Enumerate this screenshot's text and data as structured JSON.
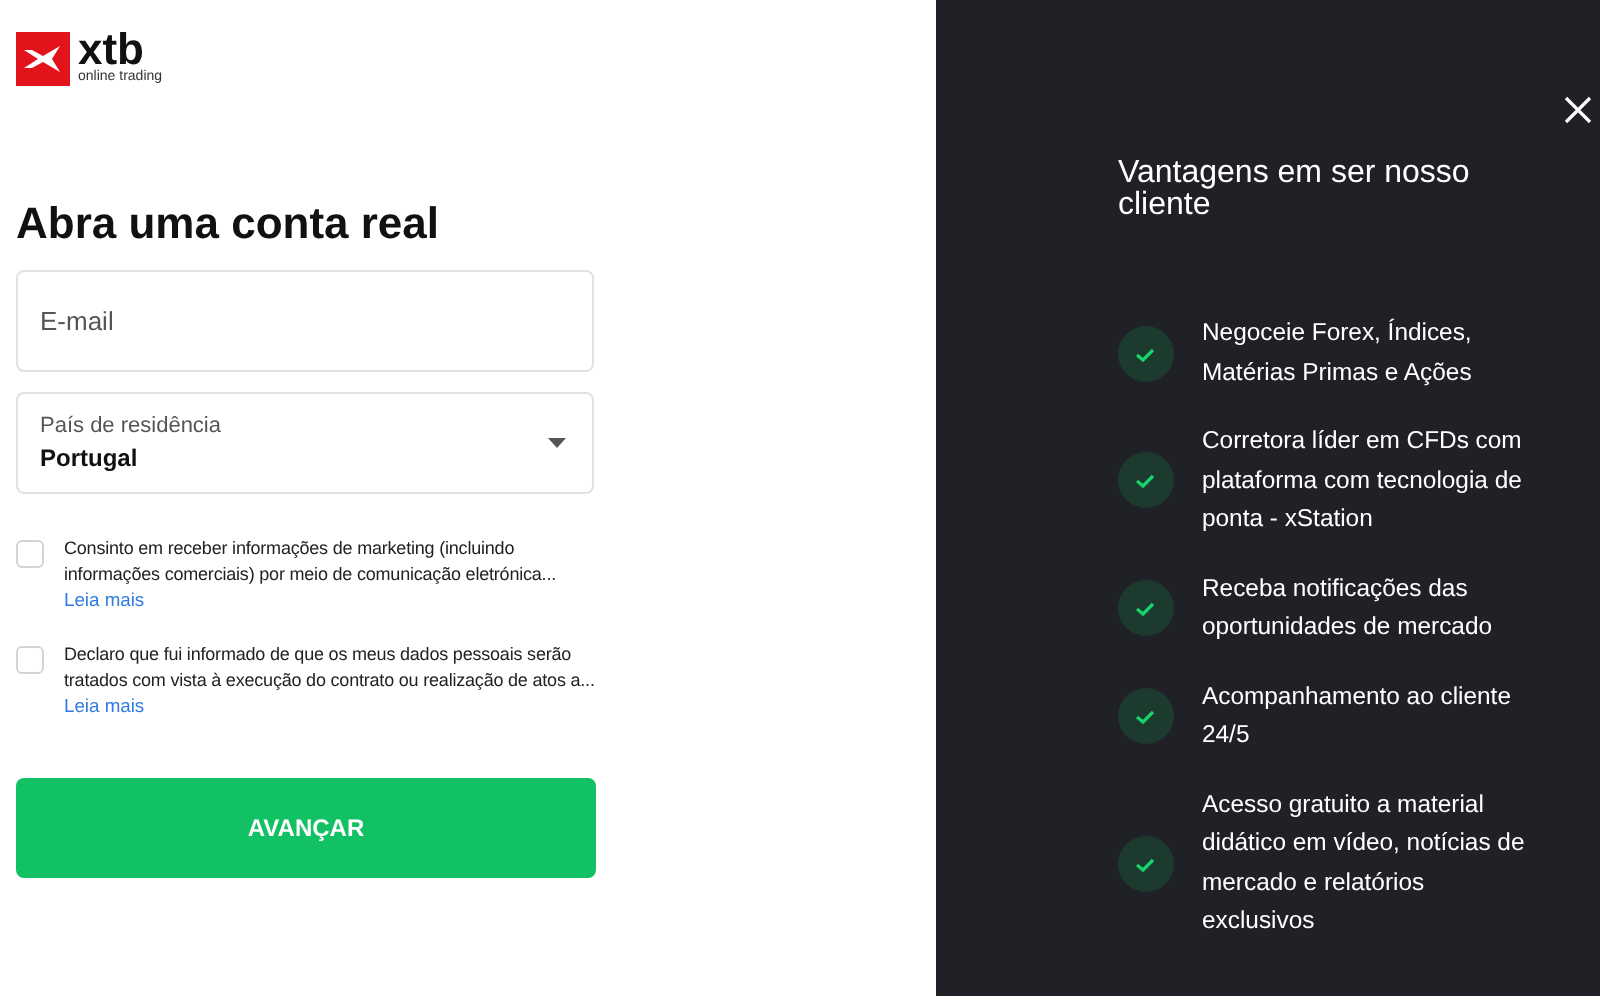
{
  "logo": {
    "wordmark": "xtb",
    "tagline": "online trading"
  },
  "heading": "Abra uma conta real",
  "email_field": {
    "placeholder": "E-mail"
  },
  "country_field": {
    "label": "País de residência",
    "value": "Portugal"
  },
  "consents": [
    {
      "text": "Consinto em receber informações de marketing (incluindo informações comerciais) por meio de comunicação eletrónica...",
      "link": "Leia mais",
      "checked": false
    },
    {
      "text": "Declaro que fui informado de que os meus dados pessoais serão tratados com vista à execução do contrato ou realização de atos a...",
      "link": "Leia mais",
      "checked": false
    }
  ],
  "submit_button": "AVANÇAR",
  "benefits_panel": {
    "title": "Vantagens em ser nosso cliente",
    "items": [
      "Negoceie Forex, Índices, Matérias Primas e Ações",
      "Corretora líder em CFDs com plataforma com tecnologia de ponta - xStation",
      "Receba notificações das oportunidades de mercado",
      "Acompanhamento ao cliente 24/5",
      "Acesso gratuito a material didático em vídeo, notícias de mercado e relatórios exclusivos"
    ]
  }
}
